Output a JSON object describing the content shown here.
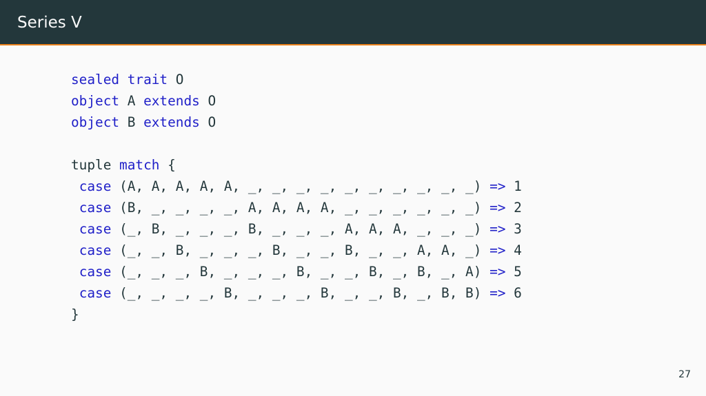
{
  "slide": {
    "title": "Series V",
    "page_number": "27"
  },
  "colors": {
    "header_background": "#23373b",
    "header_text": "#fafafa",
    "accent_rule": "#eb811b",
    "slide_background": "#fafafa",
    "code_keyword": "#1f1fc8",
    "code_text": "#23373b"
  },
  "code": {
    "lines": [
      [
        {
          "t": "sealed",
          "kw": true
        },
        {
          "t": " "
        },
        {
          "t": "trait",
          "kw": true
        },
        {
          "t": " O"
        }
      ],
      [
        {
          "t": "object",
          "kw": true
        },
        {
          "t": " A "
        },
        {
          "t": "extends",
          "kw": true
        },
        {
          "t": " O"
        }
      ],
      [
        {
          "t": "object",
          "kw": true
        },
        {
          "t": " B "
        },
        {
          "t": "extends",
          "kw": true
        },
        {
          "t": " O"
        }
      ],
      [],
      [
        {
          "t": "tuple "
        },
        {
          "t": "match",
          "kw": true
        },
        {
          "t": " {"
        }
      ],
      [
        {
          "t": " "
        },
        {
          "t": "case",
          "kw": true
        },
        {
          "t": " (A, A, A, A, A, _, _, _, _, _, _, _, _, _, _) "
        },
        {
          "t": "=>",
          "kw": true
        },
        {
          "t": " 1"
        }
      ],
      [
        {
          "t": " "
        },
        {
          "t": "case",
          "kw": true
        },
        {
          "t": " (B, _, _, _, _, A, A, A, A, _, _, _, _, _, _) "
        },
        {
          "t": "=>",
          "kw": true
        },
        {
          "t": " 2"
        }
      ],
      [
        {
          "t": " "
        },
        {
          "t": "case",
          "kw": true
        },
        {
          "t": " (_, B, _, _, _, B, _, _, _, A, A, A, _, _, _) "
        },
        {
          "t": "=>",
          "kw": true
        },
        {
          "t": " 3"
        }
      ],
      [
        {
          "t": " "
        },
        {
          "t": "case",
          "kw": true
        },
        {
          "t": " (_, _, B, _, _, _, B, _, _, B, _, _, A, A, _) "
        },
        {
          "t": "=>",
          "kw": true
        },
        {
          "t": " 4"
        }
      ],
      [
        {
          "t": " "
        },
        {
          "t": "case",
          "kw": true
        },
        {
          "t": " (_, _, _, B, _, _, _, B, _, _, B, _, B, _, A) "
        },
        {
          "t": "=>",
          "kw": true
        },
        {
          "t": " 5"
        }
      ],
      [
        {
          "t": " "
        },
        {
          "t": "case",
          "kw": true
        },
        {
          "t": " (_, _, _, _, B, _, _, _, B, _, _, B, _, B, B) "
        },
        {
          "t": "=>",
          "kw": true
        },
        {
          "t": " 6"
        }
      ],
      [
        {
          "t": "}"
        }
      ]
    ]
  }
}
